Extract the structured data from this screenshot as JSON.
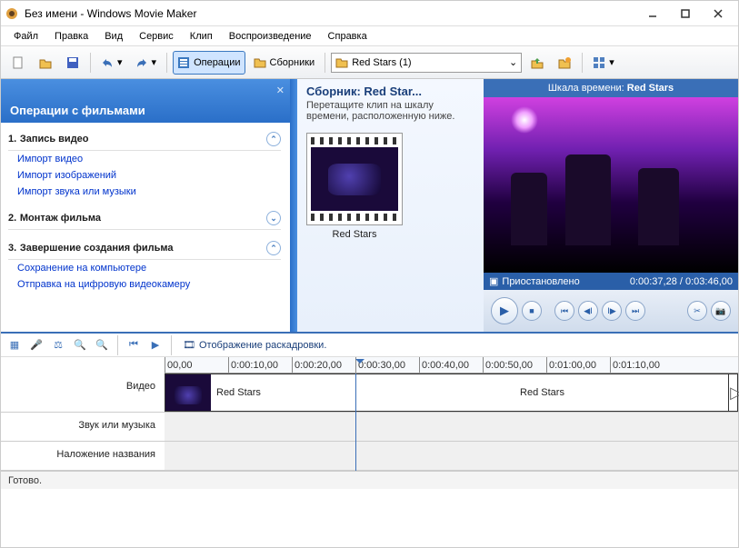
{
  "window": {
    "title": "Без имени - Windows Movie Maker"
  },
  "menu": {
    "items": [
      "Файл",
      "Правка",
      "Вид",
      "Сервис",
      "Клип",
      "Воспроизведение",
      "Справка"
    ]
  },
  "toolbar": {
    "operations": "Операции",
    "collections": "Сборники",
    "selected_collection": "Red Stars (1)"
  },
  "tasks": {
    "banner": "Операции с фильмами",
    "sections": [
      {
        "num": "1.",
        "title": "Запись видео",
        "links": [
          "Импорт видео",
          "Импорт изображений",
          "Импорт звука или музыки"
        ]
      },
      {
        "num": "2.",
        "title": "Монтаж фильма",
        "links": []
      },
      {
        "num": "3.",
        "title": "Завершение создания фильма",
        "links": [
          "Сохранение на компьютере",
          "Отправка на цифровую видеокамеру"
        ]
      }
    ]
  },
  "collection": {
    "title": "Сборник: Red Star...",
    "subtitle": "Перетащите клип на шкалу времени, расположенную ниже.",
    "clip_name": "Red Stars"
  },
  "preview": {
    "header_prefix": "Шкала времени:",
    "header_name": "Red Stars",
    "status": "Приостановлено",
    "time": "0:00:37,28 / 0:03:46,00"
  },
  "timeline": {
    "switch_label": "Отображение раскадровки.",
    "ticks": [
      "00,00",
      "0:00:10,00",
      "0:00:20,00",
      "0:00:30,00",
      "0:00:40,00",
      "0:00:50,00",
      "0:01:00,00",
      "0:01:10,00"
    ],
    "tracks": {
      "video": "Видео",
      "audio": "Звук или музыка",
      "title": "Наложение названия"
    },
    "clips": [
      {
        "name": "Red Stars"
      },
      {
        "name": "Red Stars"
      }
    ]
  },
  "status": "Готово."
}
